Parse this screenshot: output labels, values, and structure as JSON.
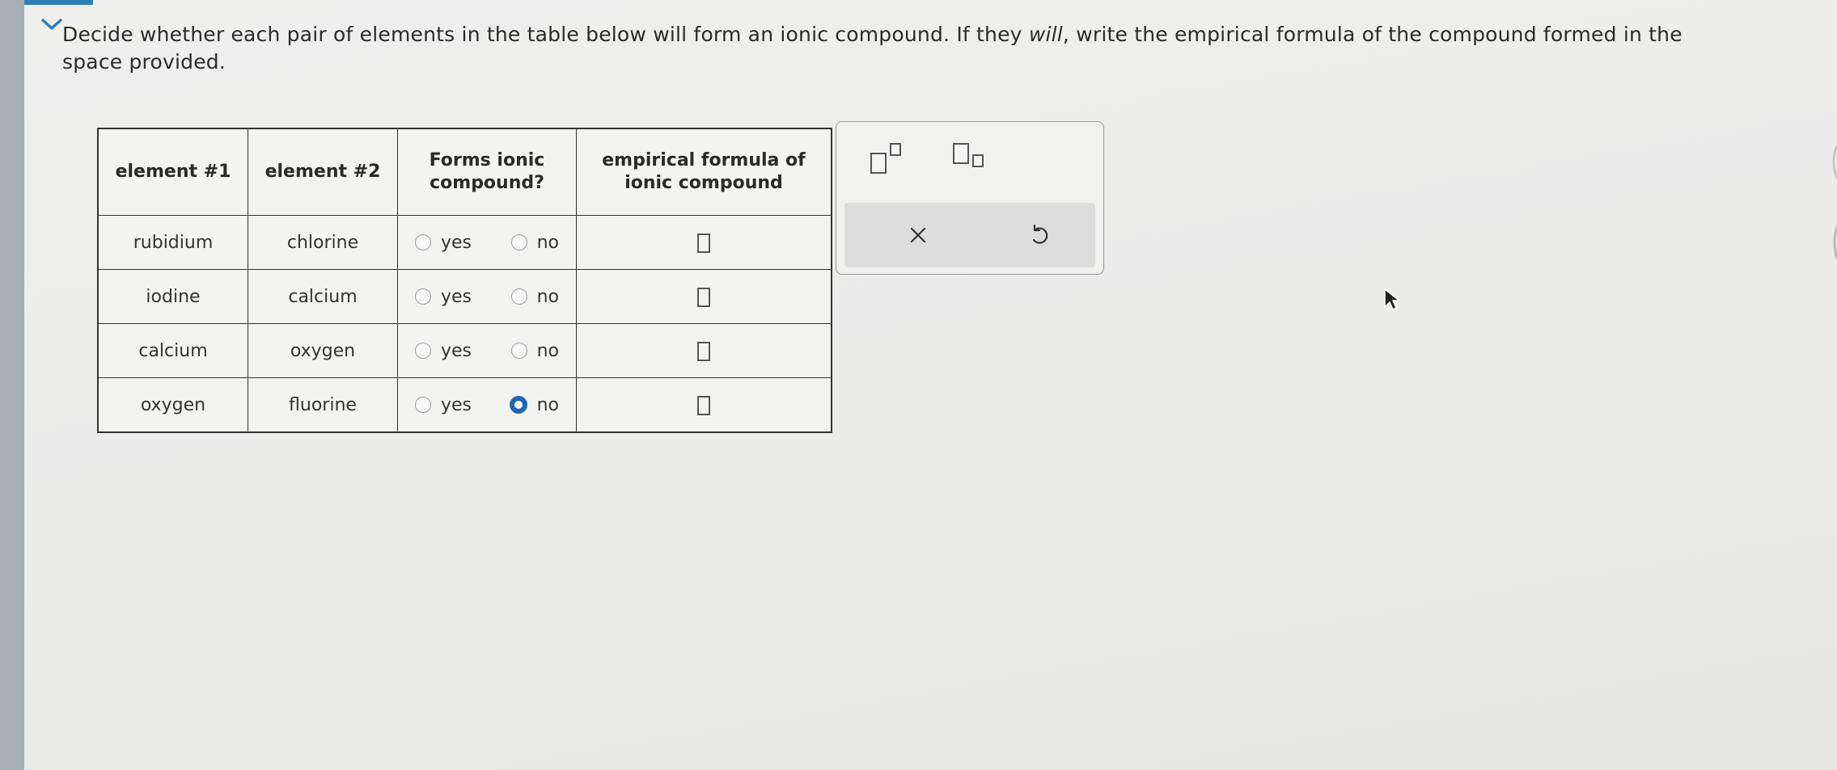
{
  "question": {
    "part1": "Decide whether each pair of elements in the table below will form an ionic compound. If they ",
    "emphasis": "will",
    "part2": ", write the empirical formula of the compound formed in the space provided."
  },
  "table": {
    "headers": [
      "element #1",
      "element #2",
      "Forms ionic compound?",
      "empirical formula of ionic compound"
    ],
    "rows": [
      {
        "element1": "rubidium",
        "element2": "chlorine",
        "selected": "none"
      },
      {
        "element1": "iodine",
        "element2": "calcium",
        "selected": "none"
      },
      {
        "element1": "calcium",
        "element2": "oxygen",
        "selected": "none"
      },
      {
        "element1": "oxygen",
        "element2": "fluorine",
        "selected": "no"
      }
    ],
    "option_yes": "yes",
    "option_no": "no"
  },
  "tools": {
    "superscript_icon": "superscript-box-icon",
    "subscript_icon": "subscript-box-icon",
    "clear_icon": "close-icon",
    "undo_icon": "undo-icon"
  },
  "colors": {
    "accent": "#1e66b5",
    "top_accent": "#2e7fb8"
  }
}
